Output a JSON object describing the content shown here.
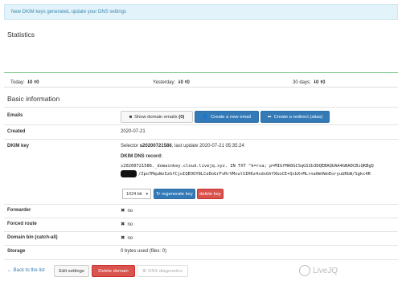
{
  "alert": {
    "text": "New DKIM keys generated, update your DNS settings"
  },
  "statistics": {
    "title": "Statistics",
    "periods": [
      {
        "label": "Today:",
        "down": "0",
        "up": "0"
      },
      {
        "label": "Yesterday:",
        "down": "0",
        "up": "0"
      },
      {
        "label": "30 days:",
        "down": "0",
        "up": "0"
      }
    ]
  },
  "basic": {
    "title": "Basic information",
    "emails_label": "Emails",
    "show_emails_label": "Show domain emails",
    "show_emails_count": "(0)",
    "create_email_label": "Create a new email",
    "create_redirect_label": "Create a redirect (alias)",
    "created_label": "Created",
    "created_value": "2020-07-21",
    "dkim_label": "DKIM key",
    "dkim_selector_prefix": "Selector",
    "dkim_selector": "s20200721586",
    "dkim_last_update": ", last update 2020-07-21 05:35:24",
    "dkim_record_label": "DKIM DNS record:",
    "dkim_record_line1": "s20200721586._domainkey.cloud.livejq.xyz. IN TXT \"k=rsa; p=MIGfMA0GCSqGSIb3DQEBAQUAA4GNADCBiQKBgQ",
    "dkim_record_line2": "/Zpo7MquWz5zbfCjoIQEOOY8LCeDoGrFvRrVMxulSIH6z4xdsGhYXboCE+QcbX+MLrna0mVWoEoryuGRbW/Sgkc4R",
    "key_size": "1024 bit",
    "regen_label": "regenerate key",
    "delete_key_label": "delete key",
    "forwarder_label": "Forwarder",
    "forwarder_value": "no",
    "forced_route_label": "Forced route",
    "forced_route_value": "no",
    "domain_bin_label": "Domain bin (catch-all)",
    "domain_bin_value": "no",
    "storage_label": "Storage",
    "storage_value": "0 bytes used (files: 0)"
  },
  "footer": {
    "back_label": "Back to the list",
    "edit_label": "Edit settings",
    "delete_label": "Delete domain",
    "dns_label": "DNS diagnostics",
    "logo_text": "LiveJQ"
  }
}
